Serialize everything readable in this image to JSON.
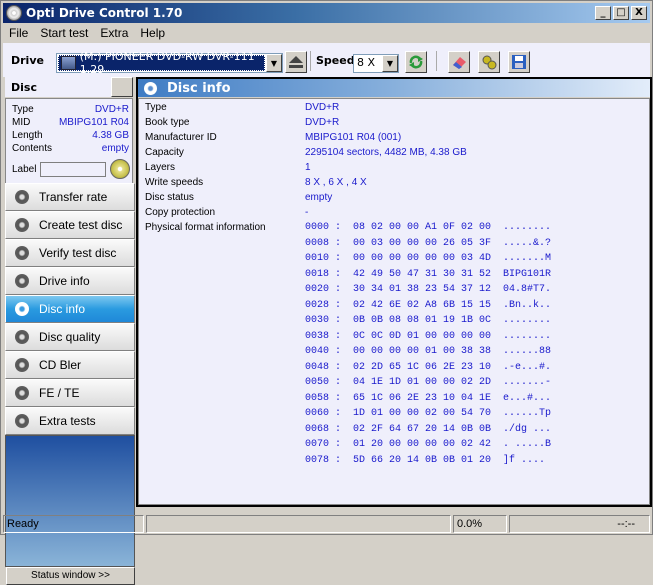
{
  "window": {
    "title": "Opti Drive Control 1.70",
    "controls": [
      "_",
      "□",
      "X"
    ]
  },
  "menu": [
    "File",
    "Start test",
    "Extra",
    "Help"
  ],
  "toolbar": {
    "drive_label": "Drive",
    "drive_value": "(M:)   PIONEER DVD-RW  DVR-111 1.29",
    "speed_label": "Speed",
    "speed_value": "8 X",
    "icons": [
      "eject-icon",
      "refresh-icon",
      "erase-icon",
      "settings-icon",
      "save-icon"
    ]
  },
  "disc_panel": {
    "title": "Disc",
    "rows": [
      {
        "k": "Type",
        "v": "DVD+R"
      },
      {
        "k": "MID",
        "v": "MBIPG101 R04"
      },
      {
        "k": "Length",
        "v": "4.38 GB"
      },
      {
        "k": "Contents",
        "v": "empty"
      }
    ],
    "label_label": "Label",
    "label_value": ""
  },
  "nav": [
    {
      "label": "Transfer rate",
      "active": false
    },
    {
      "label": "Create test disc",
      "active": false
    },
    {
      "label": "Verify test disc",
      "active": false
    },
    {
      "label": "Drive info",
      "active": false
    },
    {
      "label": "Disc info",
      "active": true
    },
    {
      "label": "Disc quality",
      "active": false
    },
    {
      "label": "CD Bler",
      "active": false
    },
    {
      "label": "FE / TE",
      "active": false
    },
    {
      "label": "Extra tests",
      "active": false
    }
  ],
  "status_window_btn": "Status window >>",
  "main": {
    "title": "Disc info",
    "info": [
      {
        "k": "Type",
        "v": "DVD+R"
      },
      {
        "k": "Book type",
        "v": "DVD+R"
      },
      {
        "k": "Manufacturer ID",
        "v": "MBIPG101 R04 (001)"
      },
      {
        "k": "Capacity",
        "v": "2295104 sectors, 4482 MB, 4.38 GB"
      },
      {
        "k": "Layers",
        "v": "1"
      },
      {
        "k": "Write speeds",
        "v": "8 X , 6 X , 4 X"
      },
      {
        "k": "Disc status",
        "v": "empty"
      },
      {
        "k": "Copy protection",
        "v": "-"
      },
      {
        "k": "Physical format information",
        "v": ""
      }
    ],
    "hex": [
      "0000 :  08 02 00 00 A1 0F 02 00  ........",
      "0008 :  00 03 00 00 00 26 05 3F  .....&.?",
      "0010 :  00 00 00 00 00 00 03 4D  .......M",
      "0018 :  42 49 50 47 31 30 31 52  BIPG101R",
      "0020 :  30 34 01 38 23 54 37 12  04.8#T7.",
      "0028 :  02 42 6E 02 A8 6B 15 15  .Bn..k..",
      "0030 :  0B 0B 08 08 01 19 1B 0C  ........",
      "0038 :  0C 0C 0D 01 00 00 00 00  ........",
      "0040 :  00 00 00 00 01 00 38 38  ......88",
      "0048 :  02 2D 65 1C 06 2E 23 10  .-e...#.",
      "0050 :  04 1E 1D 01 00 00 02 2D  .......-",
      "0058 :  65 1C 06 2E 23 10 04 1E  e...#...",
      "0060 :  1D 01 00 00 02 00 54 70  ......Tp",
      "0068 :  02 2F 64 67 20 14 0B 0B  ./dg ...",
      "0070 :  01 20 00 00 00 00 02 42  . .....B",
      "0078 :  5D 66 20 14 0B 0B 01 20  ]f ...."
    ]
  },
  "statusbar": {
    "status": "Ready",
    "progress_percent": 0.0,
    "percent_text": "0.0%",
    "time": "--:--"
  }
}
